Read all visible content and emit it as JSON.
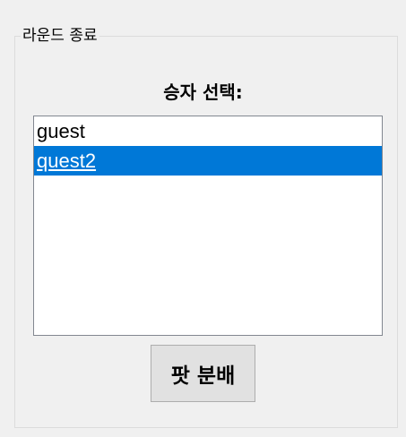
{
  "group": {
    "title": "라운드 종료"
  },
  "winner_select": {
    "label": "승자 선택:",
    "items": [
      {
        "label": "guest",
        "selected": false
      },
      {
        "label": "quest2",
        "selected": true
      }
    ]
  },
  "distribute_button": {
    "label": "팟 분배"
  },
  "colors": {
    "selection": "#0078d7",
    "background": "#f0f0f0"
  }
}
